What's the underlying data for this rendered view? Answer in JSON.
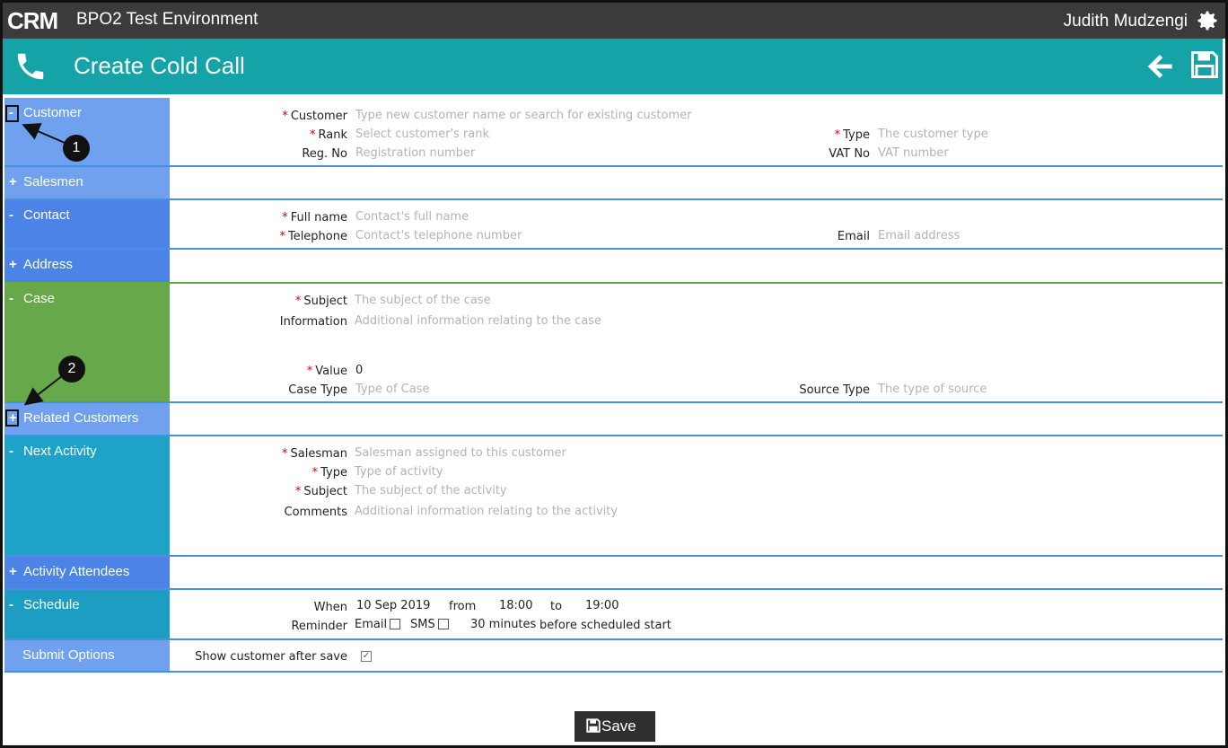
{
  "header": {
    "app_title": "BPO2 Test Environment",
    "user_name": "Judith Mudzengi",
    "logo_text": "CRM"
  },
  "titlebar": {
    "title": "Create Cold Call"
  },
  "sections": {
    "customer": {
      "toggle": "-",
      "label": "Customer",
      "customer_label": "Customer",
      "customer_ph": "Type new customer name or search for existing customer",
      "rank_label": "Rank",
      "rank_ph": "Select customer's rank",
      "type_label": "Type",
      "type_ph": "The customer type",
      "regno_label": "Reg. No",
      "regno_ph": "Registration number",
      "vat_label": "VAT No",
      "vat_ph": "VAT number"
    },
    "salesmen": {
      "toggle": "+",
      "label": "Salesmen"
    },
    "contact": {
      "toggle": "-",
      "label": "Contact",
      "fullname_label": "Full name",
      "fullname_ph": "Contact's full name",
      "tel_label": "Telephone",
      "tel_ph": "Contact's telephone number",
      "email_label": "Email",
      "email_ph": "Email address"
    },
    "address": {
      "toggle": "+",
      "label": "Address"
    },
    "case": {
      "toggle": "-",
      "label": "Case",
      "subject_label": "Subject",
      "subject_ph": "The subject of the case",
      "info_label": "Information",
      "info_ph": "Additional information relating to the case",
      "value_label": "Value",
      "value": "0",
      "casetype_label": "Case Type",
      "casetype_ph": "Type of Case",
      "source_label": "Source Type",
      "source_ph": "The type of source"
    },
    "related": {
      "toggle": "+",
      "label": "Related Customers"
    },
    "next_activity": {
      "toggle": "-",
      "label": "Next Activity",
      "salesman_label": "Salesman",
      "salesman_ph": "Salesman assigned to this customer",
      "type_label": "Type",
      "type_ph": "Type of activity",
      "subject_label": "Subject",
      "subject_ph": "The subject of the activity",
      "comments_label": "Comments",
      "comments_ph": "Additional information relating to the activity"
    },
    "attendees": {
      "toggle": "+",
      "label": "Activity Attendees"
    },
    "schedule": {
      "toggle": "-",
      "label": "Schedule",
      "when_label": "When",
      "date": "10 Sep 2019",
      "from_label": "from",
      "from_time": "18:00",
      "to_label": "to",
      "to_time": "19:00",
      "reminder_label": "Reminder",
      "email_label": "Email",
      "sms_label": "SMS",
      "minutes": "30 minutes",
      "before_text": "before scheduled start"
    },
    "submit": {
      "label": "Submit Options",
      "show_label": "Show customer after save",
      "checked_mark": "✓"
    }
  },
  "callouts": [
    "1",
    "2"
  ],
  "save_button": {
    "label": "Save"
  }
}
